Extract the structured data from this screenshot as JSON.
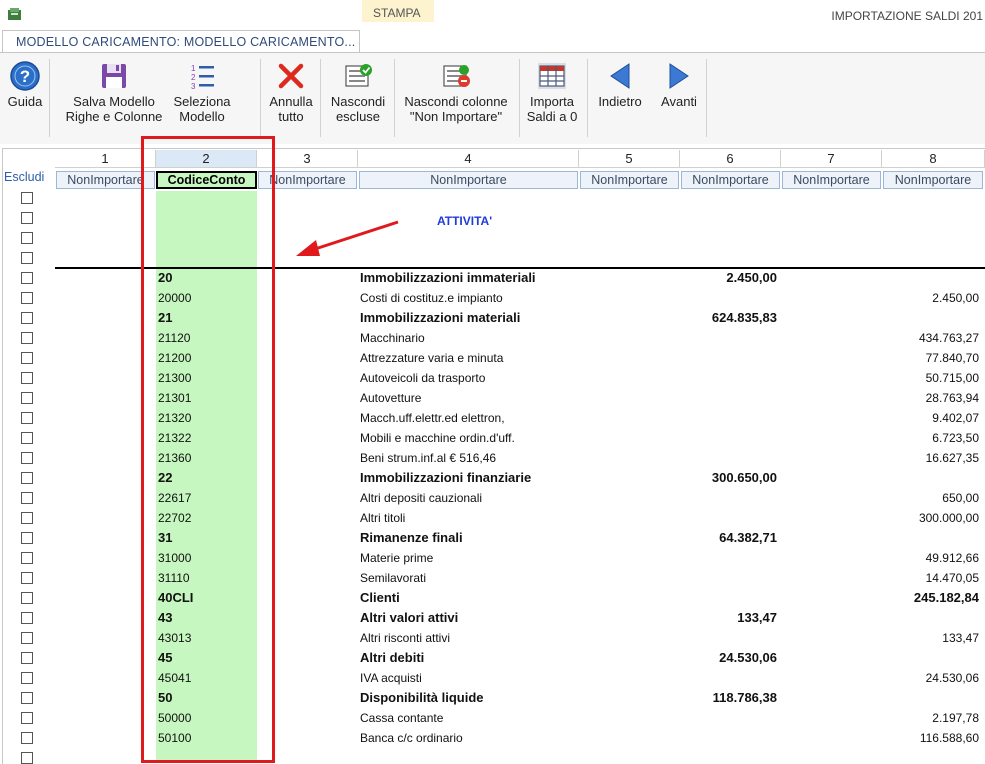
{
  "window": {
    "title": "IMPORTAZIONE SALDI 201"
  },
  "tabs": [
    {
      "label": "MODELLO CARICAMENTO: MODELLO CARICAMENTO..."
    },
    {
      "label": "STAMPA"
    }
  ],
  "ribbon": {
    "guida": "Guida",
    "salva_1": "Salva Modello",
    "salva_2": "Righe e Colonne",
    "seleziona_1": "Seleziona",
    "seleziona_2": "Modello",
    "annulla_1": "Annulla",
    "annulla_2": "tutto",
    "nascondi_1": "Nascondi",
    "nascondi_2": "escluse",
    "nascondi_col_1": "Nascondi colonne",
    "nascondi_col_2": "\"Non Importare\"",
    "importa_1": "Importa",
    "importa_2": "Saldi a 0",
    "indietro": "Indietro",
    "avanti": "Avanti"
  },
  "grid": {
    "escludi_label": "Escludi",
    "column_numbers": [
      "1",
      "2",
      "3",
      "4",
      "5",
      "6",
      "7",
      "8"
    ],
    "column_mappings": [
      "NonImportare",
      "CodiceConto",
      "NonImportare",
      "NonImportare",
      "NonImportare",
      "NonImportare",
      "NonImportare",
      "NonImportare"
    ],
    "section_title": "ATTIVITA'",
    "rows": [
      {
        "code": "20",
        "desc": "Immobilizzazioni immateriali",
        "v6": "2.450,00",
        "v8": ""
      },
      {
        "code": "20000",
        "desc": "Costi di costituz.e impianto",
        "v6": "",
        "v8": "2.450,00"
      },
      {
        "code": "21",
        "desc": "Immobilizzazioni materiali",
        "v6": "624.835,83",
        "v8": ""
      },
      {
        "code": "21120",
        "desc": "Macchinario",
        "v6": "",
        "v8": "434.763,27"
      },
      {
        "code": "21200",
        "desc": "Attrezzature varia e minuta",
        "v6": "",
        "v8": "77.840,70"
      },
      {
        "code": "21300",
        "desc": "Autoveicoli da trasporto",
        "v6": "",
        "v8": "50.715,00"
      },
      {
        "code": "21301",
        "desc": "Autovetture",
        "v6": "",
        "v8": "28.763,94"
      },
      {
        "code": "21320",
        "desc": "Macch.uff.elettr.ed elettron,",
        "v6": "",
        "v8": "9.402,07"
      },
      {
        "code": "21322",
        "desc": "Mobili e macchine ordin.d'uff.",
        "v6": "",
        "v8": "6.723,50"
      },
      {
        "code": "21360",
        "desc": "Beni strum.inf.al € 516,46",
        "v6": "",
        "v8": "16.627,35"
      },
      {
        "code": "22",
        "desc": "Immobilizzazioni finanziarie",
        "v6": "300.650,00",
        "v8": ""
      },
      {
        "code": "22617",
        "desc": "Altri depositi cauzionali",
        "v6": "",
        "v8": "650,00"
      },
      {
        "code": "22702",
        "desc": "Altri titoli",
        "v6": "",
        "v8": "300.000,00"
      },
      {
        "code": "31",
        "desc": "Rimanenze finali",
        "v6": "64.382,71",
        "v8": ""
      },
      {
        "code": "31000",
        "desc": "Materie prime",
        "v6": "",
        "v8": "49.912,66"
      },
      {
        "code": "31110",
        "desc": "Semilavorati",
        "v6": "",
        "v8": "14.470,05"
      },
      {
        "code": "40CLI",
        "desc": "Clienti",
        "v6": "",
        "v8": "245.182,84"
      },
      {
        "code": "43",
        "desc": "Altri valori attivi",
        "v6": "133,47",
        "v8": ""
      },
      {
        "code": "43013",
        "desc": "Altri risconti attivi",
        "v6": "",
        "v8": "133,47"
      },
      {
        "code": "45",
        "desc": "Altri debiti",
        "v6": "24.530,06",
        "v8": ""
      },
      {
        "code": "45041",
        "desc": "IVA acquisti",
        "v6": "",
        "v8": "24.530,06"
      },
      {
        "code": "50",
        "desc": "Disponibilità liquide",
        "v6": "118.786,38",
        "v8": ""
      },
      {
        "code": "50000",
        "desc": "Cassa contante",
        "v6": "",
        "v8": "2.197,78"
      },
      {
        "code": "50100",
        "desc": "Banca c/c ordinario",
        "v6": "",
        "v8": "116.588,60"
      }
    ]
  }
}
